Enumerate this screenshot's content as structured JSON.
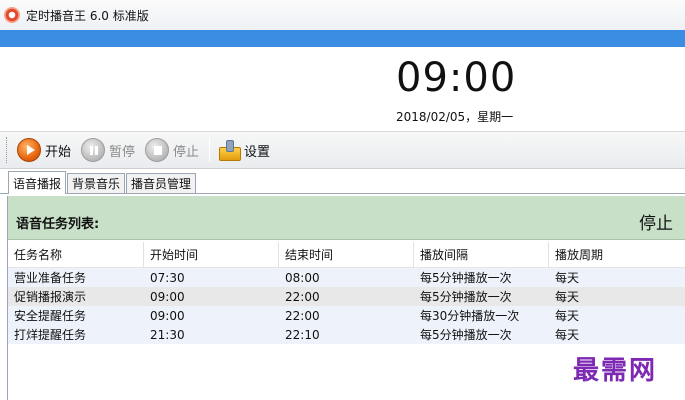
{
  "window": {
    "title": "定时播音王 6.0 标准版"
  },
  "clock": {
    "time": "09:00",
    "date": "2018/02/05，星期一"
  },
  "toolbar": {
    "start_label": "开始",
    "pause_label": "暂停",
    "stop_label": "停止",
    "settings_label": "设置"
  },
  "tabs": [
    {
      "label": "语音播报",
      "active": true
    },
    {
      "label": "背景音乐",
      "active": false
    },
    {
      "label": "播音员管理",
      "active": false
    }
  ],
  "task_panel": {
    "title": "语音任务列表:",
    "status": "停止"
  },
  "table": {
    "columns": [
      "任务名称",
      "开始时间",
      "结束时间",
      "播放间隔",
      "播放周期"
    ],
    "rows": [
      [
        "营业准备任务",
        "07:30",
        "08:00",
        "每5分钟播放一次",
        "每天"
      ],
      [
        "促销播报演示",
        "09:00",
        "22:00",
        "每5分钟播放一次",
        "每天"
      ],
      [
        "安全提醒任务",
        "09:00",
        "22:00",
        "每30分钟播放一次",
        "每天"
      ],
      [
        "打烊提醒任务",
        "21:30",
        "22:10",
        "每5分钟播放一次",
        "每天"
      ]
    ]
  },
  "watermark": "最需网",
  "colors": {
    "accent_bar": "#3b8ce3",
    "panel_header": "#c8dfc8",
    "watermark": "#7d29b3"
  }
}
